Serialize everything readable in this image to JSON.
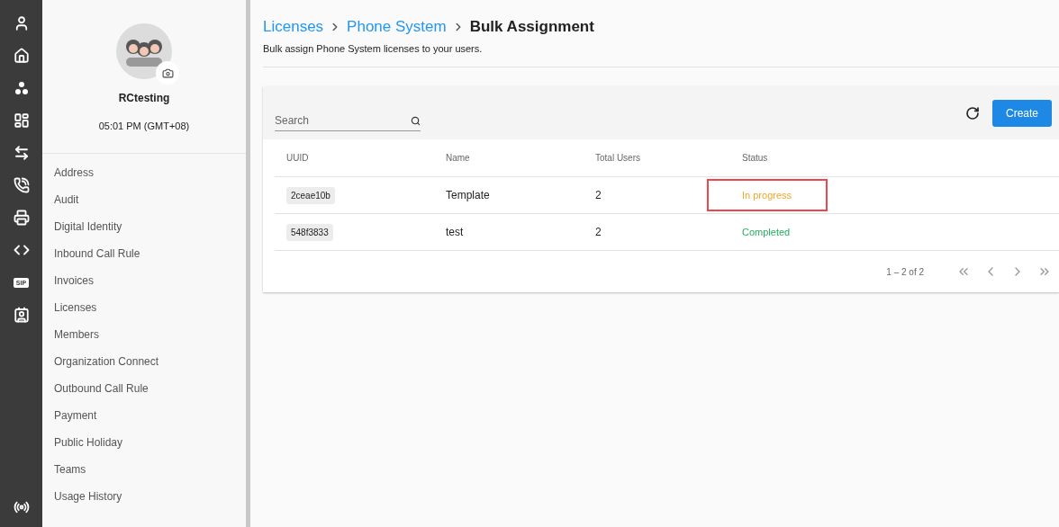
{
  "rail": [
    {
      "kind": "user"
    },
    {
      "kind": "home"
    },
    {
      "kind": "group"
    },
    {
      "kind": "dashboard"
    },
    {
      "kind": "transfer"
    },
    {
      "kind": "phone"
    },
    {
      "kind": "fax"
    },
    {
      "kind": "code"
    },
    {
      "kind": "sip",
      "label": "SIP"
    },
    {
      "kind": "contact"
    }
  ],
  "rail_bottom": {
    "kind": "broadcast"
  },
  "profile": {
    "name": "RCtesting",
    "time": "05:01 PM (GMT+08)"
  },
  "sidebar": {
    "items": [
      "Address",
      "Audit",
      "Digital Identity",
      "Inbound Call Rule",
      "Invoices",
      "Licenses",
      "Members",
      "Organization Connect",
      "Outbound Call Rule",
      "Payment",
      "Public Holiday",
      "Teams",
      "Usage History"
    ]
  },
  "breadcrumb": [
    {
      "label": "Licenses",
      "link": true
    },
    {
      "label": "Phone System",
      "link": true
    },
    {
      "label": "Bulk Assignment",
      "link": false
    }
  ],
  "subtitle": "Bulk assign Phone System licenses to your users.",
  "search": {
    "placeholder": "Search"
  },
  "create_button": "Create",
  "table": {
    "columns": [
      "UUID",
      "Name",
      "Total Users",
      "Status"
    ],
    "rows": [
      {
        "uuid": "2ceae10b",
        "name": "Template",
        "total_users": "2",
        "status": "In progress",
        "color": "#f5a623",
        "highlighted": true
      },
      {
        "uuid": "548f3833",
        "name": "test",
        "total_users": "2",
        "status": "Completed",
        "color": "#27ae60",
        "highlighted": false
      }
    ]
  },
  "pagination": {
    "range": "1 – 2 of 2"
  }
}
